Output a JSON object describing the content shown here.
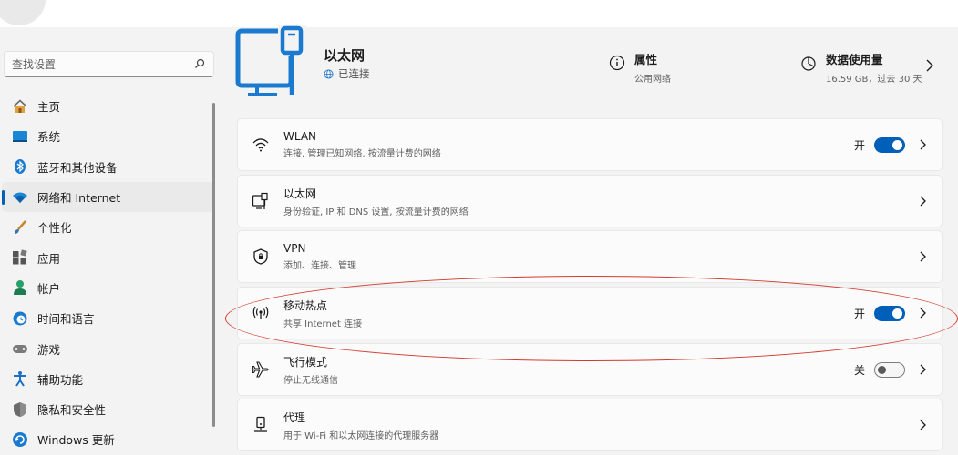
{
  "search": {
    "placeholder": "查找设置"
  },
  "nav": [
    {
      "label": "主页",
      "icon": "home-icon"
    },
    {
      "label": "系统",
      "icon": "system-icon"
    },
    {
      "label": "蓝牙和其他设备",
      "icon": "bluetooth-icon"
    },
    {
      "label": "网络和 Internet",
      "icon": "wifi-icon",
      "active": true
    },
    {
      "label": "个性化",
      "icon": "brush-icon"
    },
    {
      "label": "应用",
      "icon": "apps-icon"
    },
    {
      "label": "帐户",
      "icon": "account-icon"
    },
    {
      "label": "时间和语言",
      "icon": "globe-clock-icon"
    },
    {
      "label": "游戏",
      "icon": "gamepad-icon"
    },
    {
      "label": "辅助功能",
      "icon": "accessibility-icon"
    },
    {
      "label": "隐私和安全性",
      "icon": "shield-icon"
    },
    {
      "label": "Windows 更新",
      "icon": "update-icon"
    }
  ],
  "header": {
    "title": "以太网",
    "status": "已连接",
    "properties": {
      "title": "属性",
      "sub": "公用网络"
    },
    "usage": {
      "title": "数据使用量",
      "sub": "16.59 GB，过去 30 天"
    }
  },
  "cards": [
    {
      "title": "WLAN",
      "sub": "连接, 管理已知网络, 按流量计费的网络",
      "icon": "wifi-icon",
      "state": "开",
      "on": true
    },
    {
      "title": "以太网",
      "sub": "身份验证, IP 和 DNS 设置, 按流量计费的网络",
      "icon": "ethernet-icon"
    },
    {
      "title": "VPN",
      "sub": "添加、连接、管理",
      "icon": "vpn-shield-icon"
    },
    {
      "title": "移动热点",
      "sub": "共享 Internet 连接",
      "icon": "hotspot-icon",
      "state": "开",
      "on": true
    },
    {
      "title": "飞行模式",
      "sub": "停止无线通信",
      "icon": "airplane-icon",
      "state": "关",
      "on": false
    },
    {
      "title": "代理",
      "sub": "用于 Wi-Fi 和以太网连接的代理服务器",
      "icon": "proxy-icon"
    }
  ],
  "colors": {
    "accent": "#005fb8",
    "annotation": "#d33b2f"
  }
}
